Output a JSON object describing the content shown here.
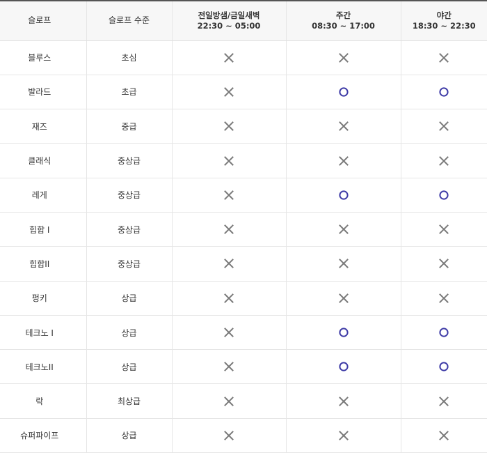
{
  "header": {
    "slope": "슬로프",
    "level": "슬로프 수준",
    "schedules": [
      {
        "name": "전일방샘/금일새벽",
        "time": "22:30 ~ 05:00"
      },
      {
        "name": "주간",
        "time": "08:30 ~ 17:00"
      },
      {
        "name": "야간",
        "time": "18:30 ~ 22:30"
      }
    ]
  },
  "rows": [
    {
      "slope": "블루스",
      "level": "초심",
      "avail": [
        "x",
        "x",
        "x"
      ]
    },
    {
      "slope": "발라드",
      "level": "초급",
      "avail": [
        "x",
        "o",
        "o"
      ]
    },
    {
      "slope": "재즈",
      "level": "중급",
      "avail": [
        "x",
        "x",
        "x"
      ]
    },
    {
      "slope": "클래식",
      "level": "중상급",
      "avail": [
        "x",
        "x",
        "x"
      ]
    },
    {
      "slope": "레게",
      "level": "중상급",
      "avail": [
        "x",
        "o",
        "o"
      ]
    },
    {
      "slope": "힙합 I",
      "level": "중상급",
      "avail": [
        "x",
        "x",
        "x"
      ]
    },
    {
      "slope": "힙합II",
      "level": "중상급",
      "avail": [
        "x",
        "x",
        "x"
      ]
    },
    {
      "slope": "펑키",
      "level": "상급",
      "avail": [
        "x",
        "x",
        "x"
      ]
    },
    {
      "slope": "테크노 I",
      "level": "상급",
      "avail": [
        "x",
        "o",
        "o"
      ]
    },
    {
      "slope": "테크노II",
      "level": "상급",
      "avail": [
        "x",
        "o",
        "o"
      ]
    },
    {
      "slope": "락",
      "level": "최상급",
      "avail": [
        "x",
        "x",
        "x"
      ]
    },
    {
      "slope": "슈퍼파이프",
      "level": "상급",
      "avail": [
        "x",
        "x",
        "x"
      ]
    }
  ],
  "icons": {
    "x": "x-mark-icon",
    "o": "circle-mark-icon"
  },
  "colors": {
    "x_mark": "#7a7a7a",
    "o_mark": "#3d3aa6",
    "header_bg": "#f7f7f7",
    "grid": "#e6e6e6"
  }
}
